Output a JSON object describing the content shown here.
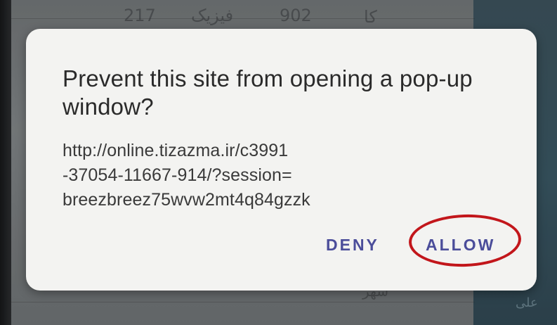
{
  "background": {
    "row_number_1": "217",
    "subject_1": "فیزیک",
    "row_number_2": "902",
    "fragment_top": "کا",
    "fragment_bottom_1": "سهر",
    "fragment_bottom_2": "علی"
  },
  "dialog": {
    "title": "Prevent this site from opening a pop-up window?",
    "url_lines": [
      "http://online.tizazma.ir/c3991",
      "-37054-11667-914/?session=",
      "breezbreez75wvw2mt4q84gzzk"
    ],
    "deny_label": "DENY",
    "allow_label": "ALLOW"
  },
  "colors": {
    "dialog_background": "#f3f3f1",
    "title_text": "#2a2a2a",
    "url_text": "#3a3a3a",
    "action_text": "#4b4d9a",
    "highlight_ring": "#c2161b"
  }
}
